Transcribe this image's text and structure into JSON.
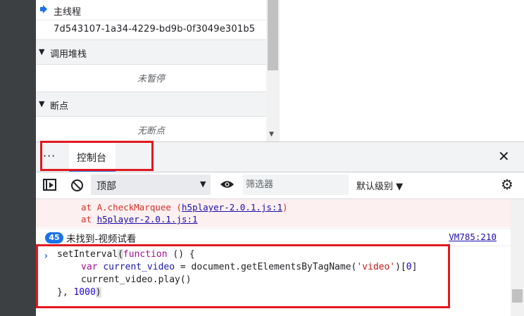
{
  "threads": {
    "main_thread_label": "主线程",
    "thread_id": "7d543107-1a34-4229-bd9b-0f3049e301b5"
  },
  "call_stack": {
    "header": "调用堆栈",
    "empty_text": "未暂停"
  },
  "breakpoints": {
    "header": "断点",
    "empty_text": "无断点"
  },
  "drawer": {
    "more_label": "···",
    "tab_console": "控制台",
    "close_label": "✕"
  },
  "toolbar": {
    "context_label": "顶部",
    "filter_placeholder": "筛选器",
    "levels_label": "默认级别 ▼"
  },
  "console": {
    "stack_lines": [
      {
        "prefix": "at A.checkMarquee (",
        "link": "h5player-2.0.1.js:1",
        "suffix": ")"
      },
      {
        "prefix": "at ",
        "link": "h5player-2.0.1.js:1",
        "suffix": ""
      }
    ],
    "log_count": "45",
    "log_message": "未找到-视频试看",
    "log_source": "VM785:210",
    "prompt": "›",
    "input_code": {
      "line1_fn": "setInterval",
      "line1_kw": "function",
      "line1_rest": " () {",
      "line2_kw": "var",
      "line2_var": "current_video",
      "line2_mid": " = document.getElementsByTagName(",
      "line2_str": "'video'",
      "line2_idx_open": ")[",
      "line2_num": "0",
      "line2_idx_close": "]",
      "line3": "current_video.play()",
      "line4_pre": "}, ",
      "line4_num": "1000",
      "line4_close": ")"
    }
  },
  "colors": {
    "highlight_red": "#e0191f",
    "accent_blue": "#1a73e8",
    "error_red": "#d93025",
    "error_bg": "#fdf0f0"
  }
}
